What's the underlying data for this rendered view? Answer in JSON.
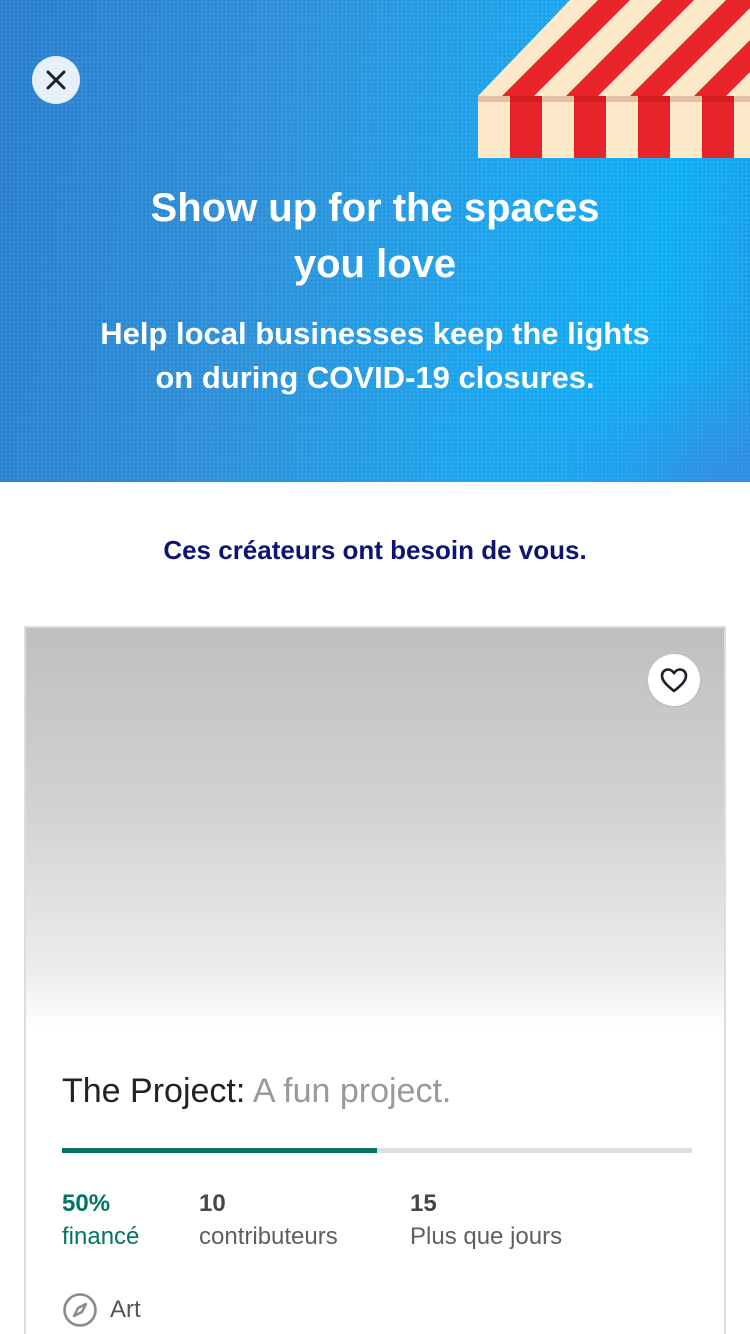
{
  "hero": {
    "title_line1": "Show up for the spaces",
    "title_line2": "you love",
    "subtitle_line1": "Help local businesses keep the lights",
    "subtitle_line2": "on during COVID-19 closures.",
    "icons": {
      "close": "close-icon",
      "awning": "awning-illustration"
    }
  },
  "section": {
    "heading": "Ces créateurs ont besoin de vous."
  },
  "card": {
    "project_name": "The Project:",
    "project_blurb": "A fun project.",
    "progress_fraction": 0.5,
    "stats": {
      "funded_value": "50%",
      "funded_label": "financé",
      "backers_value": "10",
      "backers_label": "contributeurs",
      "days_value": "15",
      "days_label": "Plus que jours"
    },
    "category": "Art",
    "icons": {
      "favorite": "heart-icon",
      "category": "compass-icon"
    }
  },
  "colors": {
    "brand_green": "#037362",
    "heading_navy": "#0f1473",
    "hero_blue": "#1ea6ee",
    "awning_red": "#e8242b",
    "awning_cream": "#fbe9c9"
  }
}
